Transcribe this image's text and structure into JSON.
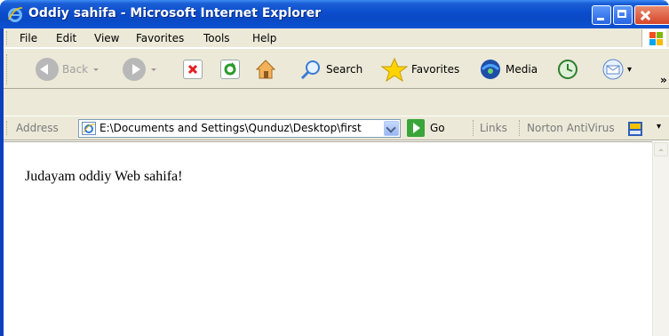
{
  "window": {
    "title": "Oddiy sahifa - Microsoft Internet Explorer"
  },
  "menu": {
    "items": [
      "File",
      "Edit",
      "View",
      "Favorites",
      "Tools",
      "Help"
    ]
  },
  "toolbar": {
    "back_label": "Back",
    "search_label": "Search",
    "favorites_label": "Favorites",
    "media_label": "Media",
    "overflow": "»"
  },
  "address": {
    "label": "Address",
    "value": "E:\\Documents and Settings\\Qunduz\\Desktop\\first",
    "go_label": "Go",
    "links_label": "Links",
    "norton_label": "Norton AntiVirus"
  },
  "page": {
    "text": "Judayam oddiy Web sahifa!"
  },
  "colors": {
    "titlebar": "#0b4ccc",
    "chrome": "#ece9d8",
    "close": "#d6462a"
  }
}
